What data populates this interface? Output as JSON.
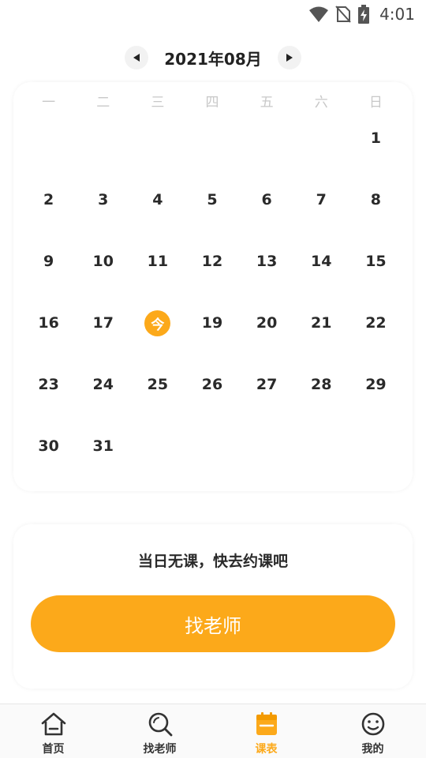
{
  "status_bar": {
    "time": "4:01",
    "icons": [
      "wifi-icon",
      "no-sim-icon",
      "battery-charging-icon"
    ]
  },
  "calendar": {
    "month_label": "2021年08月",
    "prev_icon": "triangle-left-icon",
    "next_icon": "triangle-right-icon",
    "weekdays": [
      "一",
      "二",
      "三",
      "四",
      "五",
      "六",
      "日"
    ],
    "days": [
      "1",
      "2",
      "3",
      "4",
      "5",
      "6",
      "7",
      "8",
      "9",
      "10",
      "11",
      "12",
      "13",
      "14",
      "15",
      "16",
      "17",
      "今",
      "19",
      "20",
      "21",
      "22",
      "23",
      "24",
      "25",
      "26",
      "27",
      "28",
      "29",
      "30",
      "31"
    ],
    "today_label": "今"
  },
  "empty_state": {
    "message": "当日无课，快去约课吧",
    "button_label": "找老师"
  },
  "bottom_nav": {
    "items": [
      {
        "label": "首页",
        "icon": "home-icon"
      },
      {
        "label": "找老师",
        "icon": "search-icon"
      },
      {
        "label": "课表",
        "icon": "calendar-icon"
      },
      {
        "label": "我的",
        "icon": "smiley-icon"
      }
    ],
    "active_index": 2
  },
  "colors": {
    "accent": "#FCA91A",
    "text": "#2a2a2a",
    "muted": "#c8c8c8"
  }
}
